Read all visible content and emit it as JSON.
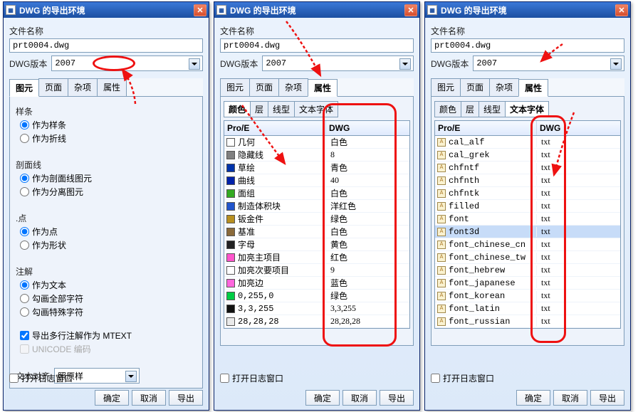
{
  "common": {
    "window_title": "DWG 的导出环境",
    "filename_label": "文件名称",
    "filename_value": "prt0004.dwg",
    "version_label": "DWG版本",
    "version_value": "2007",
    "main_tabs": [
      "图元",
      "页面",
      "杂项",
      "属性"
    ],
    "sub_tabs": [
      "颜色",
      "层",
      "线型",
      "文本字体"
    ],
    "log_label": "打开日志窗口",
    "btn_ok": "确定",
    "btn_cancel": "取消",
    "btn_export": "导出"
  },
  "panel1": {
    "active_tab": "图元",
    "groups": {
      "samples": {
        "label": "样条",
        "opt1": "作为样条",
        "opt2": "作为折线"
      },
      "section": {
        "label": "剖面线",
        "opt1": "作为剖面线图元",
        "opt2": "作为分离图元"
      },
      "point": {
        "label": ".点",
        "opt1": "作为点",
        "opt2": "作为形状"
      },
      "anno": {
        "label": "注解",
        "opt1": "作为文本",
        "opt2": "勾画全部字符",
        "opt3": "勾画特殊字符"
      },
      "mtext": "导出多行注解作为 MTEXT",
      "unicode": "UNICODE 编码",
      "align_label": "文本对齐",
      "align_value": "照原样"
    }
  },
  "panel2": {
    "active_tab": "属性",
    "active_subtab": "颜色",
    "header1": "Pro/E",
    "header2": "DWG",
    "rows": [
      {
        "swatch": "#ffffff",
        "name": "几何",
        "dwg": "白色"
      },
      {
        "swatch": "#808080",
        "name": "隐藏线",
        "dwg": "8"
      },
      {
        "swatch": "#0033aa",
        "name": "草绘",
        "dwg": "青色"
      },
      {
        "swatch": "#0022aa",
        "name": "曲线",
        "dwg": "40"
      },
      {
        "swatch": "#33aa22",
        "name": "面组",
        "dwg": "白色"
      },
      {
        "swatch": "#2255cc",
        "name": "制造体积块",
        "dwg": "洋红色"
      },
      {
        "swatch": "#b89020",
        "name": "钣金件",
        "dwg": "绿色"
      },
      {
        "swatch": "#8a6a3a",
        "name": "基准",
        "dwg": "白色"
      },
      {
        "swatch": "#222222",
        "name": "字母",
        "dwg": "黄色"
      },
      {
        "swatch": "#ff55cc",
        "name": "加亮主项目",
        "dwg": "红色"
      },
      {
        "swatch": "#ffffff",
        "name": "加亮次要项目",
        "dwg": "9"
      },
      {
        "swatch": "#ff66dd",
        "name": "加亮边",
        "dwg": "蓝色"
      },
      {
        "swatch": "#00cc44",
        "name": "0,255,0",
        "dwg": "绿色"
      },
      {
        "swatch": "#111111",
        "name": "3,3,255",
        "dwg": "3,3,255"
      },
      {
        "swatch": "#eaeaea",
        "name": "28,28,28",
        "dwg": "28,28,28"
      }
    ]
  },
  "panel3": {
    "active_tab": "属性",
    "active_subtab": "文本字体",
    "header1": "Pro/E",
    "header2": "DWG",
    "rows": [
      {
        "name": "cal_alf",
        "dwg": "txt"
      },
      {
        "name": "cal_grek",
        "dwg": "txt"
      },
      {
        "name": "chfntf",
        "dwg": "txt"
      },
      {
        "name": "chfnth",
        "dwg": "txt"
      },
      {
        "name": "chfntk",
        "dwg": "txt"
      },
      {
        "name": "filled",
        "dwg": "txt"
      },
      {
        "name": "font",
        "dwg": "txt"
      },
      {
        "name": "font3d",
        "dwg": "txt",
        "selected": true
      },
      {
        "name": "font_chinese_cn",
        "dwg": "txt"
      },
      {
        "name": "font_chinese_tw",
        "dwg": "txt"
      },
      {
        "name": "font_hebrew",
        "dwg": "txt"
      },
      {
        "name": "font_japanese",
        "dwg": "txt"
      },
      {
        "name": "font_korean",
        "dwg": "txt"
      },
      {
        "name": "font_latin",
        "dwg": "txt"
      },
      {
        "name": "font_russian",
        "dwg": "txt"
      }
    ]
  }
}
